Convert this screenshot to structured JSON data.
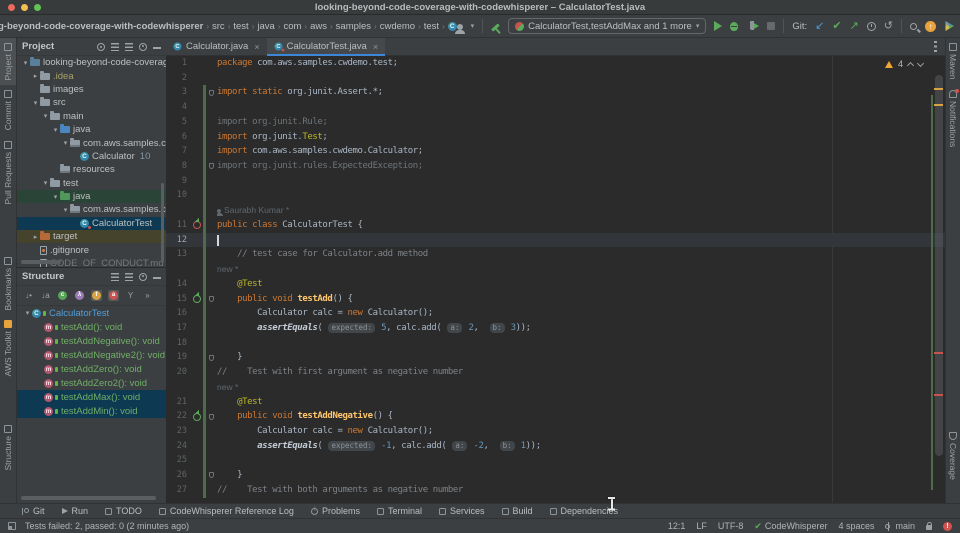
{
  "window": {
    "title": "looking-beyond-code-coverage-with-codewhisperer – CalculatorTest.java"
  },
  "toolbar": {
    "breadcrumbs": [
      "g-beyond-code-coverage-with-codewhisperer",
      "src",
      "test",
      "java",
      "com",
      "aws",
      "samples",
      "cwdemo",
      "test"
    ],
    "breadcrumb_class": "CalculatorTest",
    "run_config": "CalculatorTest,testAddMax and 1 more",
    "git_label": "Git:"
  },
  "left_stripe": {
    "top": [
      "Project",
      "Commit",
      "Pull Requests"
    ],
    "bottom": [
      "Bookmarks",
      "AWS Toolkit",
      "Structure"
    ]
  },
  "right_stripe": {
    "top": [
      "Maven",
      "Notifications"
    ],
    "bottom": [
      "Coverage"
    ]
  },
  "project_panel": {
    "title": "Project",
    "tree": [
      {
        "label": "looking-beyond-code-coverage-with-codewhisperer",
        "depth": 0,
        "arrow": "v",
        "icon": "project"
      },
      {
        "label": ".idea",
        "depth": 1,
        "arrow": ">",
        "icon": "folder",
        "cls": "olivetext"
      },
      {
        "label": "images",
        "depth": 1,
        "arrow": "",
        "icon": "folder"
      },
      {
        "label": "src",
        "depth": 1,
        "arrow": "v",
        "icon": "folder"
      },
      {
        "label": "main",
        "depth": 2,
        "arrow": "v",
        "icon": "folder"
      },
      {
        "label": "java",
        "depth": 3,
        "arrow": "v",
        "icon": "folder-src"
      },
      {
        "label": "com.aws.samples.cwdemo",
        "depth": 4,
        "arrow": "v",
        "icon": "package"
      },
      {
        "label": "Calculator",
        "depth": 5,
        "arrow": "",
        "icon": "class",
        "badge": "10"
      },
      {
        "label": "resources",
        "depth": 3,
        "arrow": "",
        "icon": "package"
      },
      {
        "label": "test",
        "depth": 2,
        "arrow": "v",
        "icon": "folder"
      },
      {
        "label": "java",
        "depth": 3,
        "arrow": "v",
        "icon": "folder-test",
        "row": "green"
      },
      {
        "label": "com.aws.samples.cwdemo",
        "depth": 4,
        "arrow": "v",
        "icon": "package"
      },
      {
        "label": "CalculatorTest",
        "depth": 5,
        "arrow": "",
        "icon": "class-test",
        "row": "sel"
      },
      {
        "label": "target",
        "depth": 1,
        "arrow": ">",
        "icon": "folder-excluded",
        "row": "olive"
      },
      {
        "label": ".gitignore",
        "depth": 1,
        "arrow": "",
        "icon": "file-git"
      },
      {
        "label": "CODE_OF_CONDUCT.md",
        "depth": 1,
        "arrow": "",
        "icon": "file",
        "cls": "dim"
      }
    ]
  },
  "structure_panel": {
    "title": "Structure",
    "toolbar_icons": [
      "sort-by-visibility",
      "sort-alphabetically",
      "show-classes",
      "show-lambdas",
      "show-fields",
      "show-anonymous",
      "filter-methods",
      "more-options"
    ],
    "items": [
      {
        "label": "CalculatorTest",
        "depth": 0,
        "arrow": "v",
        "icon": "class",
        "cls": "blue"
      },
      {
        "label": "testAdd(): void",
        "depth": 1,
        "icon": "method"
      },
      {
        "label": "testAddNegative(): void",
        "depth": 1,
        "icon": "method"
      },
      {
        "label": "testAddNegative2(): void",
        "depth": 1,
        "icon": "method"
      },
      {
        "label": "testAddZero(): void",
        "depth": 1,
        "icon": "method"
      },
      {
        "label": "testAddZero2(): void",
        "depth": 1,
        "icon": "method"
      },
      {
        "label": "testAddMax(): void",
        "depth": 1,
        "icon": "method",
        "row": "sel"
      },
      {
        "label": "testAddMin(): void",
        "depth": 1,
        "icon": "method",
        "row": "sel"
      }
    ]
  },
  "tabs": [
    {
      "label": "Calculator.java",
      "active": false
    },
    {
      "label": "CalculatorTest.java",
      "active": true
    }
  ],
  "editor": {
    "inspections": {
      "warnings": "4"
    },
    "rows": [
      {
        "n": "1",
        "tokens": [
          {
            "t": "package ",
            "s": "kw"
          },
          {
            "t": "com.aws.samples.cwdemo.test;",
            "s": "pln"
          }
        ]
      },
      {
        "n": "2",
        "tokens": []
      },
      {
        "n": "3",
        "chg": 1,
        "fold": 1,
        "tokens": [
          {
            "t": "import static ",
            "s": "kw"
          },
          {
            "t": "org.junit.Assert.*;",
            "s": "pln"
          }
        ]
      },
      {
        "n": "4",
        "chg": 1,
        "tokens": []
      },
      {
        "n": "5",
        "chg": 1,
        "tokens": [
          {
            "t": "import org.junit.Rule;",
            "s": "dim"
          }
        ]
      },
      {
        "n": "6",
        "chg": 1,
        "tokens": [
          {
            "t": "import ",
            "s": "kw"
          },
          {
            "t": "org.junit.",
            "s": "pln"
          },
          {
            "t": "Test",
            "s": "ann"
          },
          {
            "t": ";",
            "s": "pln"
          }
        ]
      },
      {
        "n": "7",
        "chg": 1,
        "tokens": [
          {
            "t": "import ",
            "s": "kw"
          },
          {
            "t": "com.aws.samples.cwdemo.Calculator;",
            "s": "pln"
          }
        ]
      },
      {
        "n": "8",
        "chg": 1,
        "fold": 1,
        "tokens": [
          {
            "t": "import org.junit.rules.ExpectedException;",
            "s": "dim"
          }
        ]
      },
      {
        "n": "9",
        "chg": 1,
        "tokens": []
      },
      {
        "n": "10",
        "chg": 1,
        "tokens": []
      },
      {
        "inlay": "Saurabh Kumar *",
        "person": true,
        "chg": 1
      },
      {
        "n": "11",
        "chg": 1,
        "gutter": "fail",
        "tokens": [
          {
            "t": "public class ",
            "s": "kw"
          },
          {
            "t": "CalculatorTest {",
            "s": "pln"
          }
        ]
      },
      {
        "n": "12",
        "chg": 1,
        "caret": true,
        "tokens": []
      },
      {
        "n": "13",
        "chg": 1,
        "tokens": [
          {
            "t": "    ",
            "s": "pln"
          },
          {
            "t": "// test case for Calculator.add method",
            "s": "cmt"
          }
        ]
      },
      {
        "inlay": "new *",
        "chg": 1
      },
      {
        "n": "14",
        "chg": 1,
        "tokens": [
          {
            "t": "    ",
            "s": "pln"
          },
          {
            "t": "@Test",
            "s": "ann"
          }
        ]
      },
      {
        "n": "15",
        "chg": 1,
        "gutter": "pass",
        "fold": 1,
        "tokens": [
          {
            "t": "    ",
            "s": "pln"
          },
          {
            "t": "public void ",
            "s": "kw"
          },
          {
            "t": "testAdd",
            "s": "mth"
          },
          {
            "t": "() {",
            "s": "pln"
          }
        ]
      },
      {
        "n": "16",
        "chg": 1,
        "tokens": [
          {
            "t": "        Calculator calc = ",
            "s": "pln"
          },
          {
            "t": "new ",
            "s": "kw"
          },
          {
            "t": "Calculator();",
            "s": "pln"
          }
        ]
      },
      {
        "n": "17",
        "chg": 1,
        "tokens": [
          {
            "t": "        ",
            "s": "pln"
          },
          {
            "t": "assertEquals",
            "s": "call"
          },
          {
            "t": "( ",
            "s": "pln"
          },
          {
            "t": "expected:",
            "s": "hint"
          },
          {
            "t": " ",
            "s": "pln"
          },
          {
            "t": "5",
            "s": "num"
          },
          {
            "t": ", calc.add( ",
            "s": "pln"
          },
          {
            "t": "a:",
            "s": "hint"
          },
          {
            "t": " ",
            "s": "pln"
          },
          {
            "t": "2",
            "s": "num"
          },
          {
            "t": ",  ",
            "s": "pln"
          },
          {
            "t": "b:",
            "s": "hint"
          },
          {
            "t": " ",
            "s": "pln"
          },
          {
            "t": "3",
            "s": "num"
          },
          {
            "t": "));",
            "s": "pln"
          }
        ]
      },
      {
        "n": "18",
        "chg": 1,
        "tokens": []
      },
      {
        "n": "19",
        "chg": 1,
        "fold": 1,
        "tokens": [
          {
            "t": "    }",
            "s": "pln"
          }
        ]
      },
      {
        "n": "20",
        "chg": 1,
        "tokens": [
          {
            "t": "//    Test with first argument as negative number",
            "s": "cmt"
          }
        ]
      },
      {
        "inlay": "new *",
        "chg": 1
      },
      {
        "n": "21",
        "chg": 1,
        "tokens": [
          {
            "t": "    ",
            "s": "pln"
          },
          {
            "t": "@Test",
            "s": "ann"
          }
        ]
      },
      {
        "n": "22",
        "chg": 1,
        "gutter": "pass",
        "fold": 1,
        "tokens": [
          {
            "t": "    ",
            "s": "pln"
          },
          {
            "t": "public void ",
            "s": "kw"
          },
          {
            "t": "testAddNegative",
            "s": "mth"
          },
          {
            "t": "() {",
            "s": "pln"
          }
        ]
      },
      {
        "n": "23",
        "chg": 1,
        "tokens": [
          {
            "t": "        Calculator calc = ",
            "s": "pln"
          },
          {
            "t": "new ",
            "s": "kw"
          },
          {
            "t": "Calculator();",
            "s": "pln"
          }
        ]
      },
      {
        "n": "24",
        "chg": 1,
        "tokens": [
          {
            "t": "        ",
            "s": "pln"
          },
          {
            "t": "assertEquals",
            "s": "call"
          },
          {
            "t": "( ",
            "s": "pln"
          },
          {
            "t": "expected:",
            "s": "hint"
          },
          {
            "t": " ",
            "s": "pln"
          },
          {
            "t": "-1",
            "s": "num"
          },
          {
            "t": ", calc.add( ",
            "s": "pln"
          },
          {
            "t": "a:",
            "s": "hint"
          },
          {
            "t": " ",
            "s": "pln"
          },
          {
            "t": "-2",
            "s": "num"
          },
          {
            "t": ",  ",
            "s": "pln"
          },
          {
            "t": "b:",
            "s": "hint"
          },
          {
            "t": " ",
            "s": "pln"
          },
          {
            "t": "1",
            "s": "num"
          },
          {
            "t": "));",
            "s": "pln"
          }
        ]
      },
      {
        "n": "25",
        "chg": 1,
        "tokens": []
      },
      {
        "n": "26",
        "chg": 1,
        "fold": 1,
        "tokens": [
          {
            "t": "    }",
            "s": "pln"
          }
        ]
      },
      {
        "n": "27",
        "chg": 1,
        "tokens": [
          {
            "t": "//    Test with both arguments as negative number",
            "s": "cmt"
          }
        ]
      }
    ],
    "scrollbar": {
      "yellow_marks": [
        32,
        48
      ],
      "red_marks": [
        296,
        338
      ]
    }
  },
  "bottom_bar": {
    "items": [
      "Git",
      "Run",
      "TODO",
      "CodeWhisperer Reference Log",
      "Problems",
      "Terminal",
      "Services",
      "Build",
      "Dependencies"
    ]
  },
  "status_bar": {
    "left": "Tests failed: 2, passed: 0 (2 minutes ago)",
    "caret": "12:1",
    "line_ending": "LF",
    "encoding": "UTF-8",
    "codewhisperer": "CodeWhisperer",
    "indent": "4 spaces",
    "branch": "main"
  },
  "colors": {
    "selection": "#0d3a52",
    "test_root_row": "#2a4437",
    "excluded_row": "#46432c",
    "active_tab_underline": "#3e86d8",
    "change_bar": "#4e6b4a",
    "run_green": "#5caa5c",
    "fail_red": "#c75450",
    "warning_yellow": "#f0a732"
  }
}
